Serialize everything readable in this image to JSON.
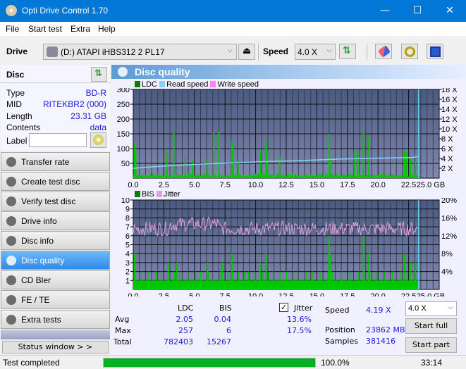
{
  "window": {
    "title": "Opti Drive Control 1.70",
    "minimize": "—",
    "maximize": "☐",
    "close": "✕"
  },
  "menu": [
    "File",
    "Start test",
    "Extra",
    "Help"
  ],
  "toolbar": {
    "drive_label": "Drive",
    "drive_value": "(D:)  ATAPI iHBS312  2 PL17",
    "speed_label": "Speed",
    "speed_value": "4.0 X"
  },
  "disc": {
    "header": "Disc",
    "fields": [
      {
        "key": "Type",
        "value": "BD-R"
      },
      {
        "key": "MID",
        "value": "RITEKBR2 (000)"
      },
      {
        "key": "Length",
        "value": "23.31 GB"
      },
      {
        "key": "Contents",
        "value": "data"
      }
    ],
    "label_key": "Label",
    "label_value": ""
  },
  "nav": [
    {
      "label": "Transfer rate",
      "active": false
    },
    {
      "label": "Create test disc",
      "active": false
    },
    {
      "label": "Verify test disc",
      "active": false
    },
    {
      "label": "Drive info",
      "active": false
    },
    {
      "label": "Disc info",
      "active": false
    },
    {
      "label": "Disc quality",
      "active": true
    },
    {
      "label": "CD Bler",
      "active": false
    },
    {
      "label": "FE / TE",
      "active": false
    },
    {
      "label": "Extra tests",
      "active": false
    }
  ],
  "status_window_btn": "Status window > >",
  "panel_title": "Disc quality",
  "chart_data": [
    {
      "type": "bar",
      "title": "LDC / Read speed",
      "legend": [
        "LDC",
        "Read speed",
        "Write speed"
      ],
      "legend_colors": {
        "LDC": "#008000",
        "Read speed": "#87cefa",
        "Write speed": "#ff80ff"
      },
      "xlabel": "GB",
      "xlim": [
        0,
        25
      ],
      "x_ticks": [
        "0.0",
        "2.5",
        "5.0",
        "7.5",
        "10.0",
        "12.5",
        "15.0",
        "17.5",
        "20.0",
        "22.5",
        "25.0 GB"
      ],
      "ylim": [
        0,
        300
      ],
      "y_ticks": [
        "50",
        "100",
        "150",
        "200",
        "250",
        "300"
      ],
      "y2lim": [
        0,
        18
      ],
      "y2_ticks": [
        "2 X",
        "4 X",
        "6 X",
        "8 X",
        "10 X",
        "12 X",
        "14 X",
        "16 X",
        "18 X"
      ],
      "ldc_spikes": [
        [
          0.05,
          115
        ],
        [
          0.15,
          90
        ],
        [
          2.7,
          90
        ],
        [
          3.25,
          157
        ],
        [
          4.2,
          70
        ],
        [
          4.8,
          60
        ],
        [
          6.0,
          65
        ],
        [
          6.5,
          155
        ],
        [
          6.95,
          157
        ],
        [
          8.0,
          125
        ],
        [
          8.1,
          100
        ],
        [
          8.5,
          65
        ],
        [
          10.35,
          95
        ],
        [
          10.8,
          130
        ],
        [
          10.9,
          95
        ],
        [
          11.9,
          75
        ],
        [
          15.95,
          150
        ],
        [
          16.1,
          70
        ],
        [
          18.0,
          90
        ],
        [
          18.3,
          92
        ],
        [
          18.75,
          157
        ],
        [
          19.2,
          140
        ],
        [
          22.1,
          90
        ],
        [
          22.25,
          88
        ],
        [
          22.6,
          68
        ],
        [
          23.0,
          55
        ]
      ],
      "ldc_baseline": 10,
      "read_speed": [
        [
          0,
          2.0
        ],
        [
          1,
          2.2
        ],
        [
          2.2,
          2.4
        ],
        [
          3.5,
          2.6
        ],
        [
          5,
          2.8
        ],
        [
          7,
          3.0
        ],
        [
          9,
          3.2
        ],
        [
          11,
          3.4
        ],
        [
          13,
          3.5
        ],
        [
          15,
          3.7
        ],
        [
          17,
          3.9
        ],
        [
          19,
          4.0
        ],
        [
          21,
          4.1
        ],
        [
          22.8,
          4.2
        ],
        [
          23.3,
          4.4
        ]
      ],
      "scan_end": 23.31
    },
    {
      "type": "bar",
      "title": "BIS / Jitter",
      "legend": [
        "BIS",
        "Jitter"
      ],
      "legend_colors": {
        "BIS": "#008000",
        "Jitter": "#dda0dd"
      },
      "xlabel": "GB",
      "xlim": [
        0,
        25
      ],
      "x_ticks": [
        "0.0",
        "2.5",
        "5.0",
        "7.5",
        "10.0",
        "12.5",
        "15.0",
        "17.5",
        "20.0",
        "22.5",
        "25.0 GB"
      ],
      "ylim": [
        0,
        10
      ],
      "y_ticks": [
        "1",
        "2",
        "3",
        "4",
        "5",
        "6",
        "7",
        "8",
        "9",
        "10"
      ],
      "y2lim": [
        0,
        20
      ],
      "y2_ticks": [
        "4%",
        "8%",
        "12%",
        "16%",
        "20%"
      ],
      "bis_spikes": [
        [
          0.05,
          4
        ],
        [
          2.8,
          3
        ],
        [
          3.5,
          3
        ],
        [
          6.0,
          3
        ],
        [
          7.2,
          3
        ],
        [
          8.0,
          4
        ],
        [
          10.3,
          3
        ],
        [
          10.8,
          4
        ],
        [
          15.95,
          6
        ],
        [
          16.05,
          4
        ],
        [
          18.75,
          6
        ],
        [
          19.2,
          4
        ],
        [
          22.1,
          4
        ],
        [
          22.6,
          3
        ],
        [
          23.0,
          3
        ]
      ],
      "jitter_mean_pct": 13.6,
      "jitter_max_pct": 17.5,
      "scan_end": 23.31
    }
  ],
  "stats": {
    "col_ldc": "LDC",
    "col_bis": "BIS",
    "jitter_label": "Jitter",
    "jitter_checked": true,
    "rows": [
      {
        "label": "Avg",
        "ldc": "2.05",
        "bis": "0.04",
        "jitter": "13.6%"
      },
      {
        "label": "Max",
        "ldc": "257",
        "bis": "6",
        "jitter": "17.5%"
      },
      {
        "label": "Total",
        "ldc": "782403",
        "bis": "15267",
        "jitter": ""
      }
    ],
    "speed_label": "Speed",
    "speed_value": "4.19 X",
    "position_label": "Position",
    "position_value": "23862 MB",
    "samples_label": "Samples",
    "samples_value": "381416",
    "speed_select": "4.0 X",
    "start_full": "Start full",
    "start_part": "Start part"
  },
  "status": {
    "text": "Test completed",
    "progress_pct": 100,
    "progress_text": "100.0%",
    "time": "33:14"
  }
}
